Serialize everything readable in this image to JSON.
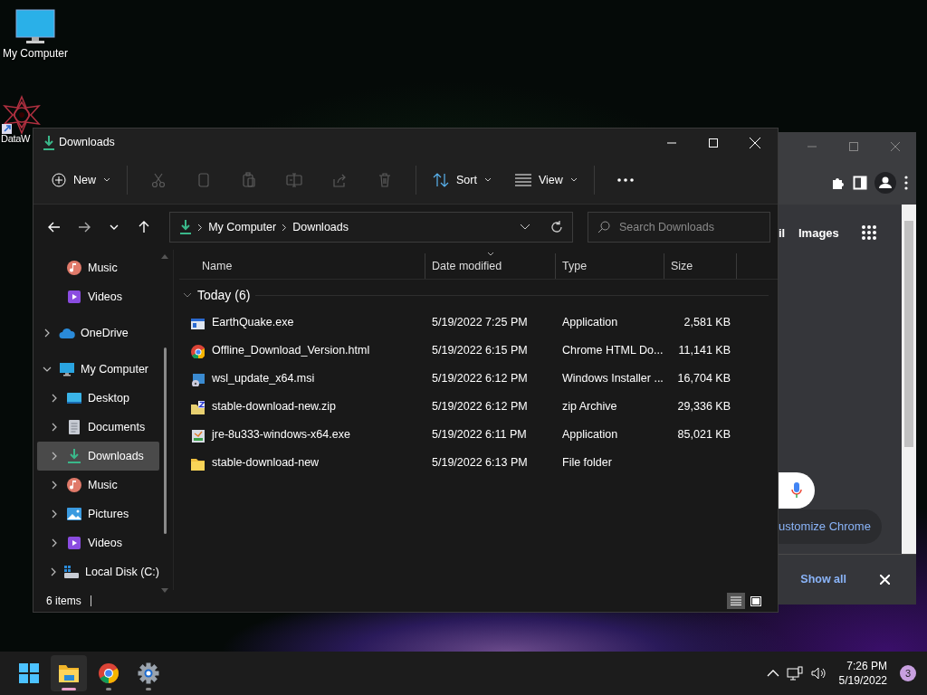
{
  "desktop_icons": [
    {
      "label": "My Computer",
      "kind": "monitor"
    },
    {
      "label": "DataW",
      "kind": "star"
    }
  ],
  "browser_window": {
    "tab_text": "il",
    "link": "Images",
    "customize": "ustomize Chrome",
    "download_bar": {
      "show_all": "Show all"
    }
  },
  "explorer": {
    "title": "Downloads",
    "toolbar": {
      "new_label": "New",
      "actions": [
        {
          "kind": "cut",
          "disabled": true
        },
        {
          "kind": "copy",
          "disabled": true
        },
        {
          "kind": "paste",
          "disabled": true
        },
        {
          "kind": "rename",
          "disabled": true
        },
        {
          "kind": "share",
          "disabled": true
        },
        {
          "kind": "delete",
          "disabled": true
        }
      ],
      "sort_label": "Sort",
      "view_label": "View"
    },
    "address": {
      "breadcrumbs": [
        "My Computer",
        "Downloads"
      ],
      "search": {
        "placeholder": "Search Downloads"
      }
    },
    "nav": [
      {
        "children": [
          {
            "label": "Music",
            "kind": "music",
            "selected": false
          },
          {
            "label": "Videos",
            "kind": "videos",
            "selected": false
          }
        ]
      },
      {
        "label": "OneDrive",
        "kind": "cloud",
        "expanded": false,
        "selected": false
      },
      {
        "label": "My Computer",
        "kind": "monitor",
        "expanded": true,
        "selected": false,
        "children": [
          {
            "label": "Desktop",
            "kind": "desktop",
            "expanded": false,
            "selected": false
          },
          {
            "label": "Documents",
            "kind": "documents",
            "expanded": false,
            "selected": false
          },
          {
            "label": "Downloads",
            "kind": "downloads",
            "expanded": false,
            "selected": true
          },
          {
            "label": "Music",
            "kind": "music",
            "expanded": false,
            "selected": false
          },
          {
            "label": "Pictures",
            "kind": "pictures",
            "expanded": false,
            "selected": false
          },
          {
            "label": "Videos",
            "kind": "videos",
            "expanded": false,
            "selected": false
          },
          {
            "label": "Local Disk (C:)",
            "kind": "disk",
            "expanded": false,
            "selected": false
          }
        ]
      }
    ],
    "columns": [
      {
        "label": "Name",
        "sorted": false
      },
      {
        "label": "Date modified",
        "sorted": true
      },
      {
        "label": "Type",
        "sorted": false
      },
      {
        "label": "Size",
        "sorted": false
      }
    ],
    "group": {
      "label": "Today (6)",
      "expanded": true
    },
    "files": [
      {
        "name": "EarthQuake.exe",
        "date": "5/19/2022 7:25 PM",
        "type": "Application",
        "size": "2,581 KB",
        "kind": "exe",
        "selected": false
      },
      {
        "name": "Offline_Download_Version.html",
        "date": "5/19/2022 6:15 PM",
        "type": "Chrome HTML Do...",
        "size": "11,141 KB",
        "kind": "chrome",
        "selected": false
      },
      {
        "name": "wsl_update_x64.msi",
        "date": "5/19/2022 6:12 PM",
        "type": "Windows Installer ...",
        "size": "16,704 KB",
        "kind": "msi",
        "selected": false
      },
      {
        "name": "stable-download-new.zip",
        "date": "5/19/2022 6:12 PM",
        "type": "zip Archive",
        "size": "29,336 KB",
        "kind": "zip",
        "selected": false
      },
      {
        "name": "jre-8u333-windows-x64.exe",
        "date": "5/19/2022 6:11 PM",
        "type": "Application",
        "size": "85,021 KB",
        "kind": "installer",
        "selected": false
      },
      {
        "name": "stable-download-new",
        "date": "5/19/2022 6:13 PM",
        "type": "File folder",
        "kind": "folder",
        "selected": false
      }
    ],
    "status": "6 items",
    "view_modes": [
      {
        "kind": "details",
        "selected": true
      },
      {
        "kind": "tiles",
        "selected": false
      }
    ]
  },
  "taskbar": {
    "apps": [
      {
        "kind": "start",
        "running": false,
        "active": false
      },
      {
        "kind": "explorer",
        "running": true,
        "active": true
      },
      {
        "kind": "chrome",
        "running": true,
        "active": false
      },
      {
        "kind": "settings",
        "running": true,
        "active": false
      }
    ],
    "time": "7:26 PM",
    "date": "5/19/2022",
    "notifications": "3"
  }
}
